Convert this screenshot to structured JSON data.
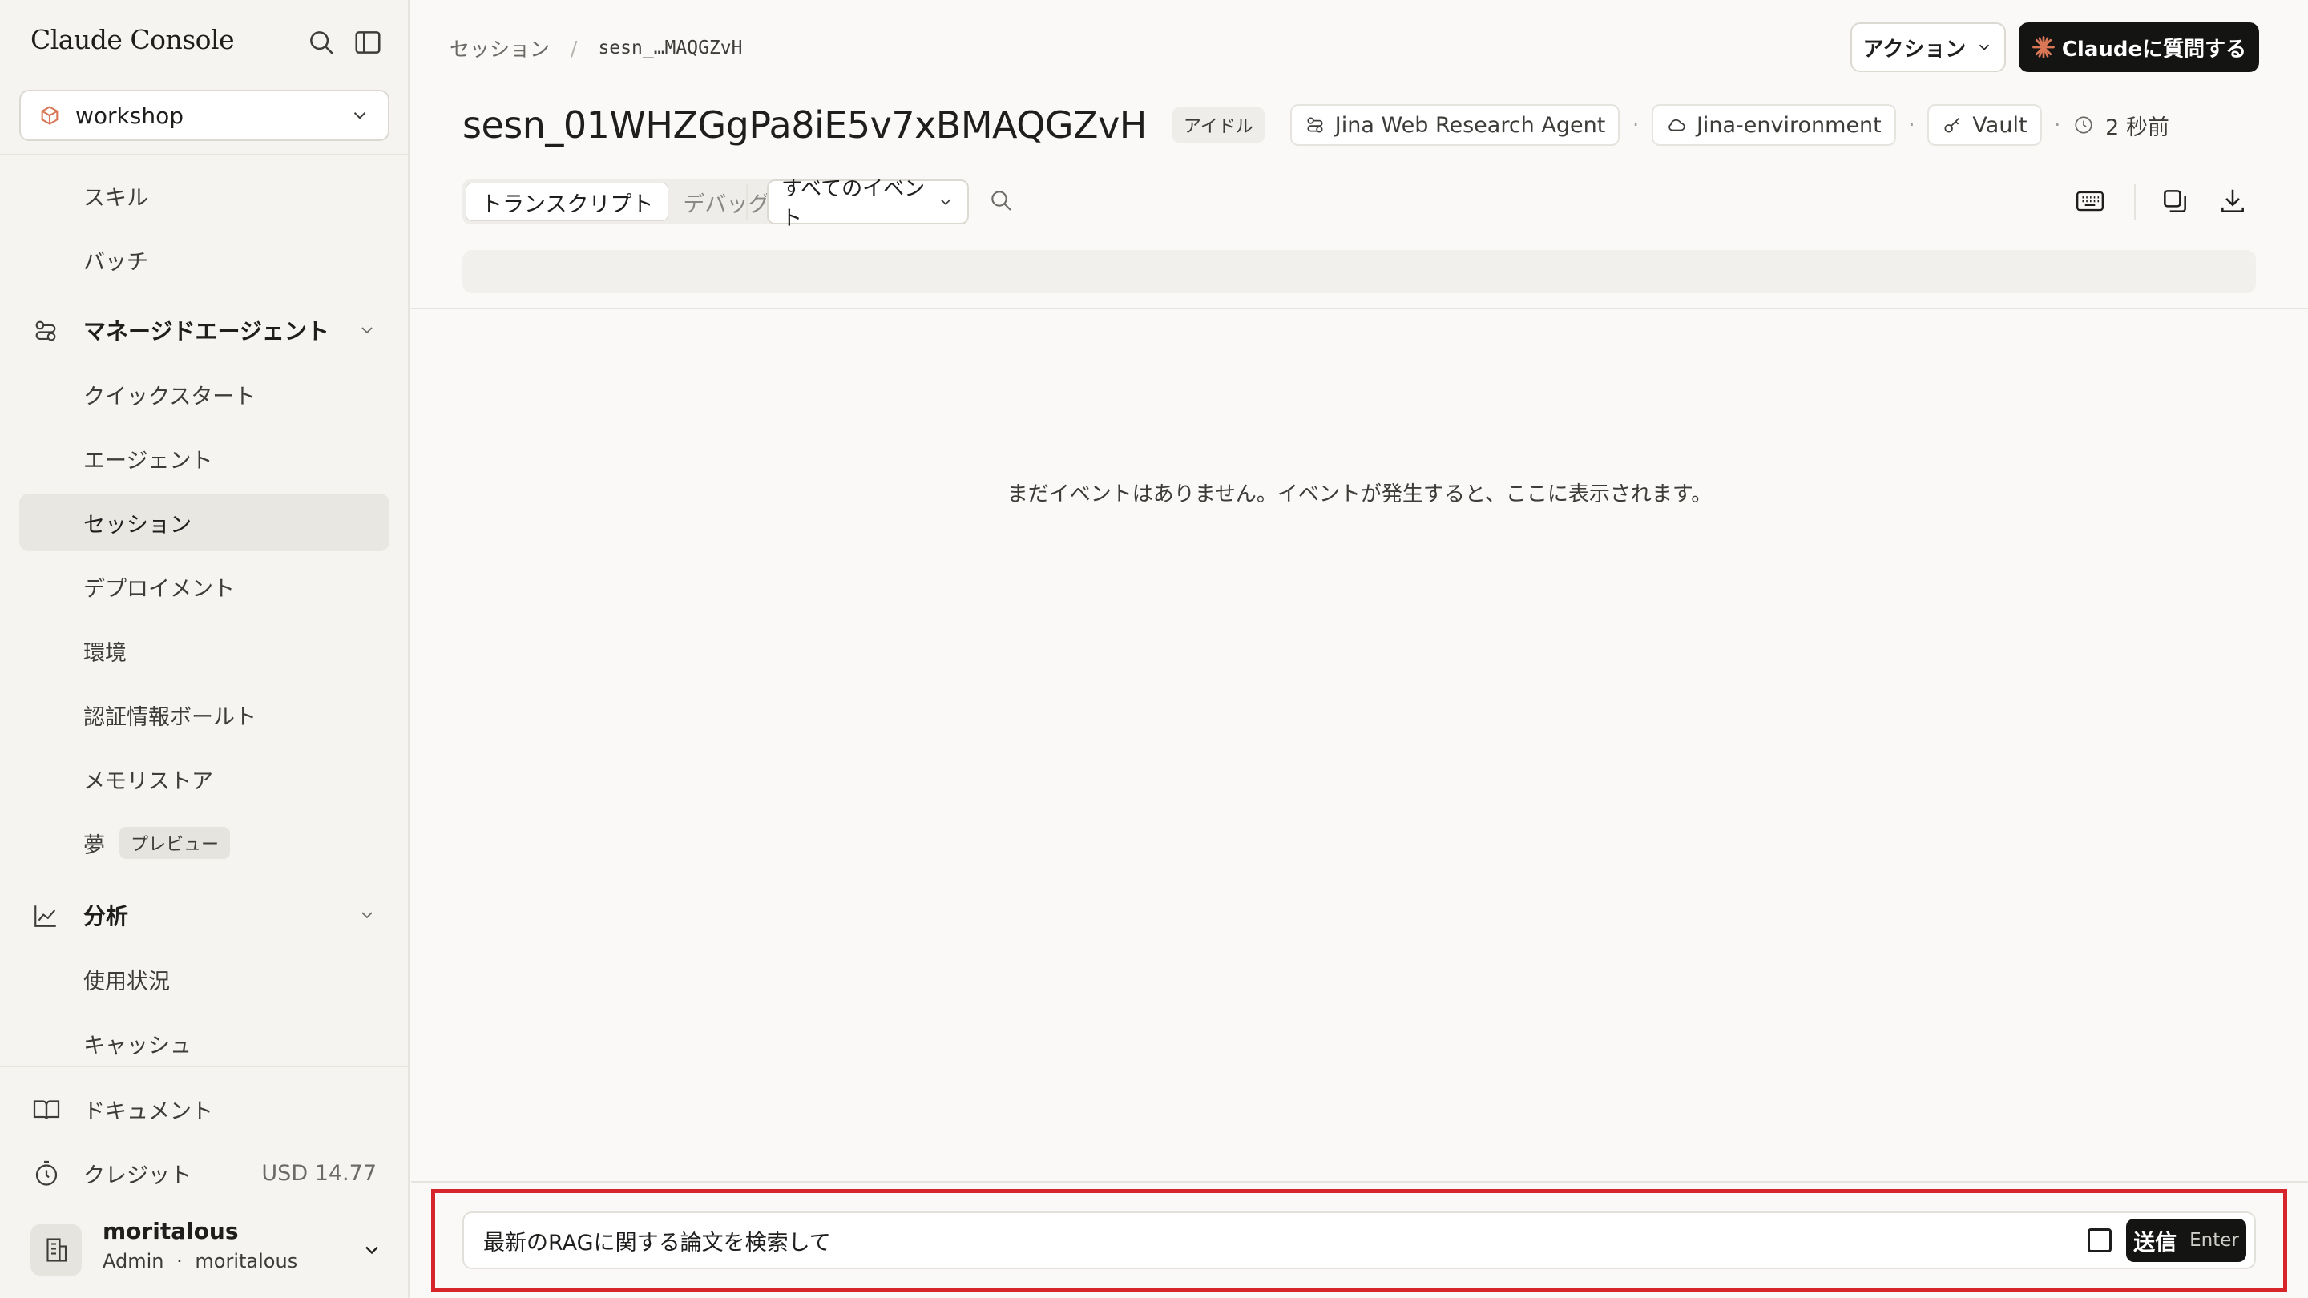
{
  "app": {
    "brand": "Claude Console"
  },
  "workspace": {
    "selected": "workshop"
  },
  "sidebar": {
    "items": [
      {
        "label": "スキル"
      },
      {
        "label": "バッチ"
      }
    ],
    "managed_agents": {
      "label": "マネージドエージェント",
      "items": [
        {
          "label": "クイックスタート"
        },
        {
          "label": "エージェント"
        },
        {
          "label": "セッション",
          "active": true
        },
        {
          "label": "デプロイメント"
        },
        {
          "label": "環境"
        },
        {
          "label": "認証情報ボールト"
        },
        {
          "label": "メモリストア"
        },
        {
          "label": "夢",
          "badge": "プレビュー"
        }
      ]
    },
    "analytics": {
      "label": "分析",
      "items": [
        {
          "label": "使用状況"
        },
        {
          "label": "キャッシュ"
        }
      ]
    },
    "footer": {
      "docs": "ドキュメント",
      "credits": "クレジット",
      "credits_value": "USD 14.77"
    },
    "user": {
      "name": "moritalous",
      "role": "Admin",
      "separator": "·",
      "org": "moritalous"
    }
  },
  "header": {
    "breadcrumb": {
      "parent": "セッション",
      "separator": "/",
      "current": "sesn_…MAQGZvH"
    },
    "actions_label": "アクション",
    "ask_claude_label": "Claudeに質問する"
  },
  "session": {
    "title": "sesn_01WHZGgPa8iE5v7xBMAQGZvH",
    "status": "アイドル",
    "agent": "Jina Web Research Agent",
    "environment": "Jina-environment",
    "vault": "Vault",
    "separator": "·",
    "time": "2 秒前"
  },
  "toolbar": {
    "tabs": [
      {
        "label": "トランスクリプト",
        "active": true
      },
      {
        "label": "デバッグ"
      }
    ],
    "filter": "すべてのイベント"
  },
  "events": {
    "empty_message": "まだイベントはありません。イベントが発生すると、ここに表示されます。"
  },
  "composer": {
    "value": "最新のRAGに関する論文を検索して",
    "send_label": "送信",
    "send_key": "Enter"
  },
  "colors": {
    "accent": "#d97757",
    "highlight": "#d7262b",
    "button_dark": "#141413"
  }
}
